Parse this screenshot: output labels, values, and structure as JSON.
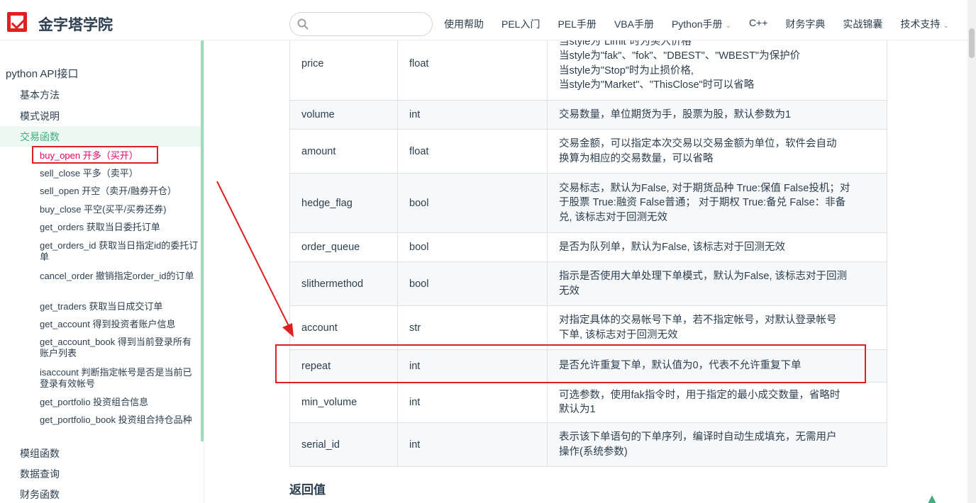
{
  "header": {
    "site_title": "金字塔学院",
    "search_placeholder": "",
    "nav": [
      {
        "label": "使用帮助",
        "dropdown": false
      },
      {
        "label": "PEL入门",
        "dropdown": false
      },
      {
        "label": "PEL手册",
        "dropdown": false
      },
      {
        "label": "VBA手册",
        "dropdown": false
      },
      {
        "label": "Python手册",
        "dropdown": true
      },
      {
        "label": "C++",
        "dropdown": false
      },
      {
        "label": "财务字典",
        "dropdown": false
      },
      {
        "label": "实战锦囊",
        "dropdown": false
      },
      {
        "label": "技术支持",
        "dropdown": true
      }
    ]
  },
  "sidebar": {
    "group_title": "python API接口",
    "sections": [
      "基本方法",
      "模式说明",
      "交易函数"
    ],
    "items": [
      "buy_open 开多（买开）",
      "sell_close 平多（卖平）",
      "sell_open 开空（卖开/融券开仓）",
      "buy_close 平空(买平/买券还券)",
      "get_orders 获取当日委托订单",
      "get_orders_id 获取当日指定id的委托订单",
      "cancel_order 撤销指定order_id的订单",
      "get_traders 获取当日成交订单",
      "get_account 得到投资者账户信息",
      "get_account_book 得到当前登录所有账户列表",
      "isaccount 判断指定帐号是否是当前已登录有效帐号",
      "get_portfolio 投资组合信息",
      "get_portfolio_book 投资组合持仓品种"
    ],
    "bottom_sections": [
      "模组函数",
      "数据查询",
      "财务函数"
    ]
  },
  "table": {
    "rows": [
      {
        "name": "price",
        "type": "float",
        "desc": [
          "当style为\"Limit\"时为买入价格",
          "当style为\"fak\"、\"fok\"、\"DBEST\"、\"WBEST\"为保护价",
          "当style为\"Stop\"时为止损价格,",
          "当style为\"Market\"、\"ThisClose\"时可以省略"
        ]
      },
      {
        "name": "volume",
        "type": "int",
        "desc": [
          "交易数量，单位期货为手，股票为股，默认参数为1"
        ]
      },
      {
        "name": "amount",
        "type": "float",
        "desc": [
          "交易金额，可以指定本次交易以交易金额为单位，软件会自动",
          "换算为相应的交易数量，可以省略"
        ]
      },
      {
        "name": "hedge_flag",
        "type": "bool",
        "desc": [
          "交易标志，默认为False, 对于期货品种 True:保值 False投机；对",
          "于股票 True:融资 False普通； 对于期权 True:备兑 False：非备",
          "兑, 该标志对于回测无效"
        ]
      },
      {
        "name": "order_queue",
        "type": "bool",
        "desc": [
          "是否为队列单，默认为False, 该标志对于回测无效"
        ]
      },
      {
        "name": "slithermethod",
        "type": "bool",
        "desc": [
          "指示是否使用大单处理下单模式，默认为False, 该标志对于回测",
          "无效"
        ]
      },
      {
        "name": "account",
        "type": "str",
        "desc": [
          "对指定具体的交易帐号下单，若不指定帐号，对默认登录帐号",
          "下单, 该标志对于回测无效"
        ]
      },
      {
        "name": "repeat",
        "type": "int",
        "desc": [
          "是否允许重复下单，默认值为0，代表不允许重复下单"
        ]
      },
      {
        "name": "min_volume",
        "type": "int",
        "desc": [
          "可选参数，使用fak指令时，用于指定的最小成交数量，省略时",
          "默认为1"
        ]
      },
      {
        "name": "serial_id",
        "type": "int",
        "desc": [
          "表示该下单语句的下单序列，编译时自动生成填充，无需用户",
          "操作(系统参数)"
        ]
      }
    ]
  },
  "return_title": "返回值",
  "colors": {
    "accent": "#3eaf7c",
    "highlight": "#e02020",
    "current_link": "#e6006a"
  }
}
